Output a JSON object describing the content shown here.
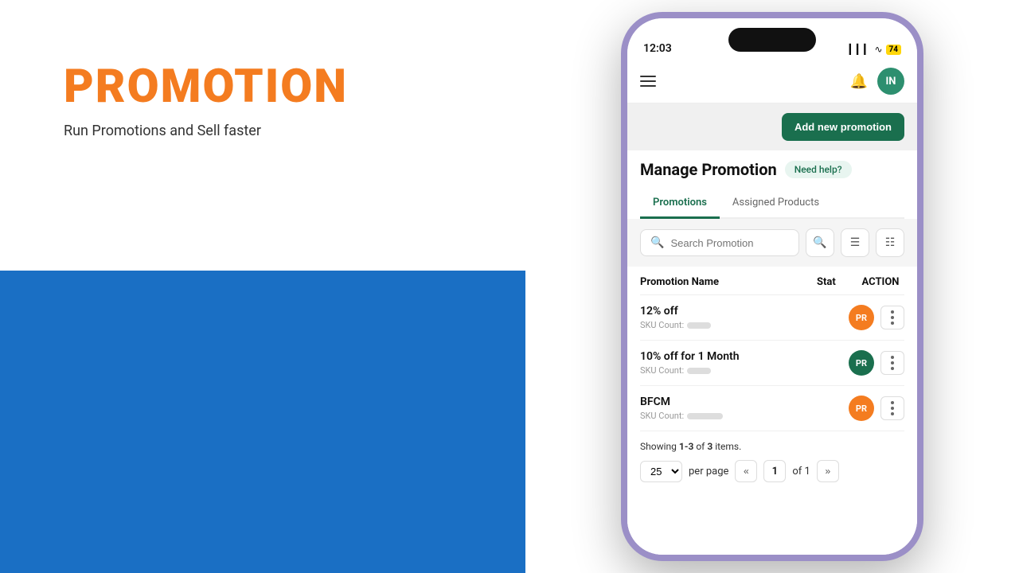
{
  "left": {
    "title": "PROMOTION",
    "subtitle": "Run Promotions and Sell faster"
  },
  "phone": {
    "status_bar": {
      "time": "12:03",
      "battery": "74"
    },
    "nav": {
      "avatar_initials": "IN"
    },
    "header": {
      "add_button_label": "Add new promotion"
    },
    "manage": {
      "title": "Manage Promotion",
      "help_badge": "Need help?"
    },
    "tabs": [
      {
        "label": "Promotions",
        "active": true
      },
      {
        "label": "Assigned Products",
        "active": false
      }
    ],
    "search": {
      "placeholder": "Search Promotion"
    },
    "table": {
      "columns": {
        "name": "Promotion Name",
        "status": "Stat",
        "action": "ACTION"
      },
      "rows": [
        {
          "name": "12% off",
          "sku_label": "SKU Count:",
          "status": "PR",
          "status_color": "orange"
        },
        {
          "name": "10% off for 1 Month",
          "sku_label": "SKU Count:",
          "status": "PR",
          "status_color": "green"
        },
        {
          "name": "BFCM",
          "sku_label": "SKU Count:",
          "status": "PR",
          "status_color": "orange"
        }
      ]
    },
    "pagination": {
      "showing_text": "Showing ",
      "range": "1-3",
      "of_text": " of ",
      "total": "3",
      "items_text": " items.",
      "per_page": "25",
      "per_page_label": "per page",
      "current_page": "1",
      "total_pages": "of 1"
    }
  }
}
